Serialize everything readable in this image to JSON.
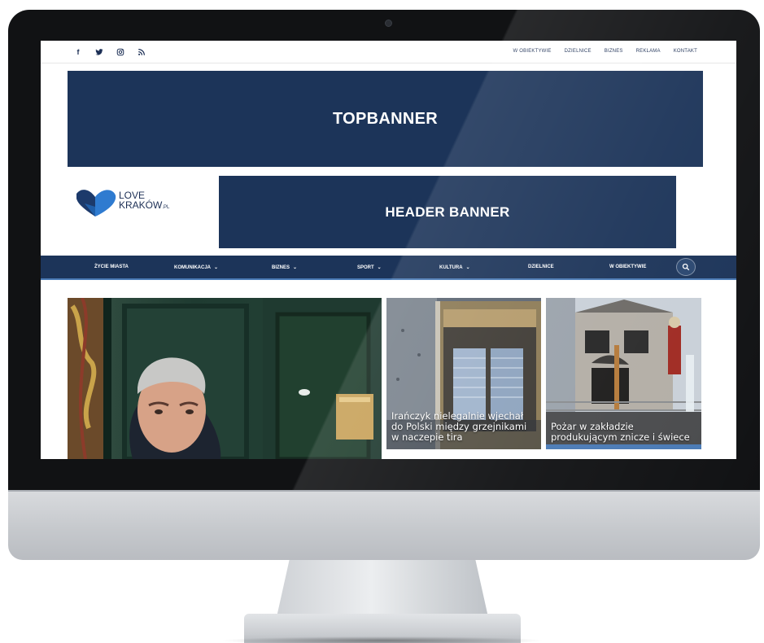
{
  "topbar": {
    "socials": [
      {
        "icon": "facebook-icon",
        "glyph": "f"
      },
      {
        "icon": "twitter-icon"
      },
      {
        "icon": "instagram-icon"
      },
      {
        "icon": "rss-icon"
      }
    ],
    "links": [
      "W OBIEKTYWIE",
      "DZIELNICE",
      "BIZNES",
      "REKLAMA",
      "KONTAKT"
    ]
  },
  "banners": {
    "top": "TOPBANNER",
    "header": "HEADER BANNER"
  },
  "logo": {
    "line1": "LOVE",
    "line2": "KRAKÓW",
    "suffix": ".PL",
    "colors": {
      "heart_dark": "#1c3a6b",
      "heart_light": "#2f7bd0"
    }
  },
  "nav": {
    "items": [
      {
        "label": "ŻYCIE MIASTA",
        "dropdown": false
      },
      {
        "label": "KOMUNIKACJA",
        "dropdown": true
      },
      {
        "label": "BIZNES",
        "dropdown": true
      },
      {
        "label": "SPORT",
        "dropdown": true
      },
      {
        "label": "KULTURA",
        "dropdown": true
      },
      {
        "label": "DZIELNICE",
        "dropdown": false
      },
      {
        "label": "W OBIEKTYWIE",
        "dropdown": false
      }
    ],
    "chevron": "⌄"
  },
  "articles": [
    {
      "caption": ""
    },
    {
      "caption": "Irańczyk nielegalnie wjechał do Polski między grzejnikami w naczepie tira"
    },
    {
      "caption": "Pożar w zakładzie produkującym znicze i świece"
    }
  ],
  "colors": {
    "navy": "#1c3459",
    "accent": "#4a7ab5"
  }
}
